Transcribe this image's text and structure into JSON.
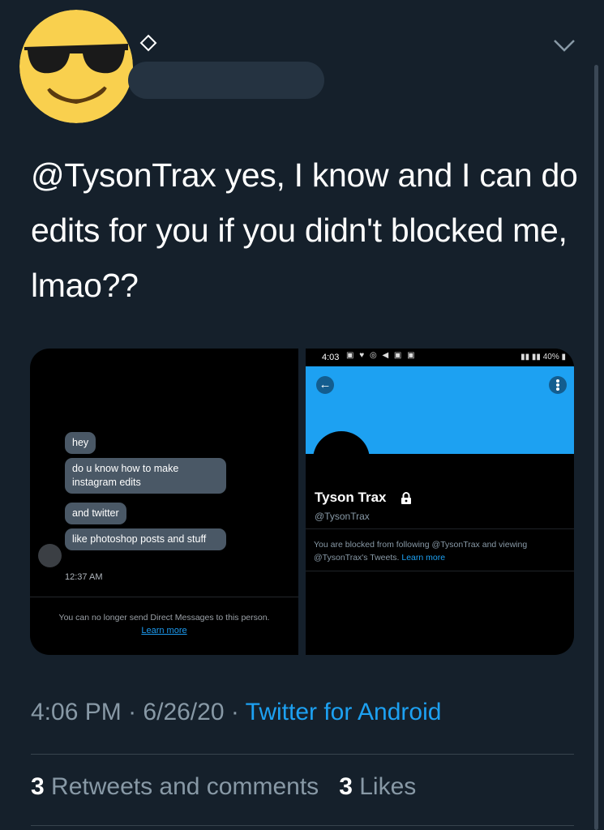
{
  "tweet": {
    "text": "@TysonTrax yes, I know and I can do edits for you if you didn't blocked me, lmao??",
    "time": "4:06 PM",
    "separator1": "·",
    "date": "6/26/20",
    "separator2": "·",
    "source": "Twitter for Android"
  },
  "stats": {
    "retweets_count": "3",
    "retweets_label": "Retweets and comments",
    "likes_count": "3",
    "likes_label": "Likes"
  },
  "media": {
    "dm": {
      "messages": [
        "hey",
        "do u know how to make instagram edits",
        "and twitter",
        "like photoshop posts and stuff"
      ],
      "time": "12:37 AM",
      "blocked_notice": "You can no longer send Direct Messages to this person.",
      "learn_more": "Learn more"
    },
    "profile": {
      "status_time": "4:03",
      "status_battery": "40%",
      "name": "Tyson Trax",
      "handle": "@TysonTrax",
      "blocked_text": "You are blocked from following @TysonTrax and viewing @TysonTrax's Tweets.",
      "learn_more": "Learn more"
    }
  },
  "colors": {
    "background": "#15202b",
    "accent": "#1da1f2",
    "muted": "#8899a6"
  },
  "icons": [
    "sunglasses-emoji-avatar",
    "diamond-icon",
    "chevron-down-icon",
    "back-arrow-icon",
    "more-vertical-icon",
    "lock-icon"
  ]
}
